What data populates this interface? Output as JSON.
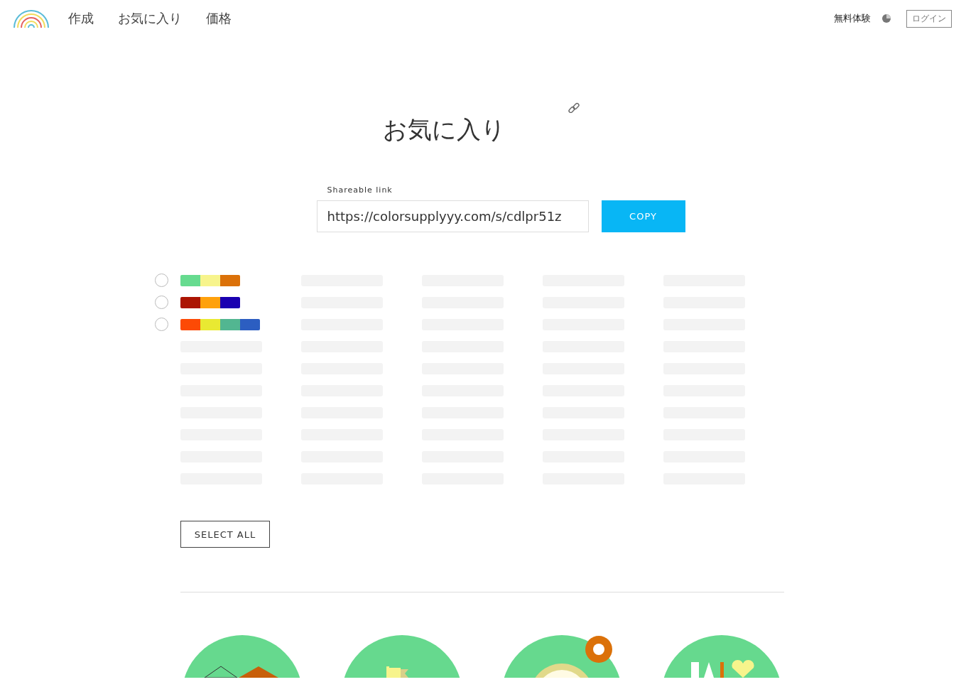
{
  "nav": {
    "items": [
      {
        "label": "作成"
      },
      {
        "label": "お気に入り"
      },
      {
        "label": "価格"
      }
    ],
    "trial": "無料体験",
    "login": "ログイン"
  },
  "title": "お気に入り",
  "share": {
    "label": "Shareable link",
    "value": "https://colorsupplyyy.com/s/cdlpr51z",
    "button": "COPY"
  },
  "palettes": [
    {
      "selected": false,
      "swatches": [
        {
          "color": "#66db8f"
        },
        {
          "color": "#f7f48c"
        },
        {
          "color": "#db7109"
        }
      ]
    },
    {
      "selected": false,
      "swatches": [
        {
          "color": "#ac1503"
        },
        {
          "color": "#ffa10c"
        },
        {
          "color": "#1a00b1"
        }
      ]
    },
    {
      "selected": false,
      "swatches": [
        {
          "color": "#fd4a05"
        },
        {
          "color": "#e9e932"
        },
        {
          "color": "#52b691"
        },
        {
          "color": "#2c5ec1"
        }
      ]
    }
  ],
  "select_all": "SELECT ALL"
}
